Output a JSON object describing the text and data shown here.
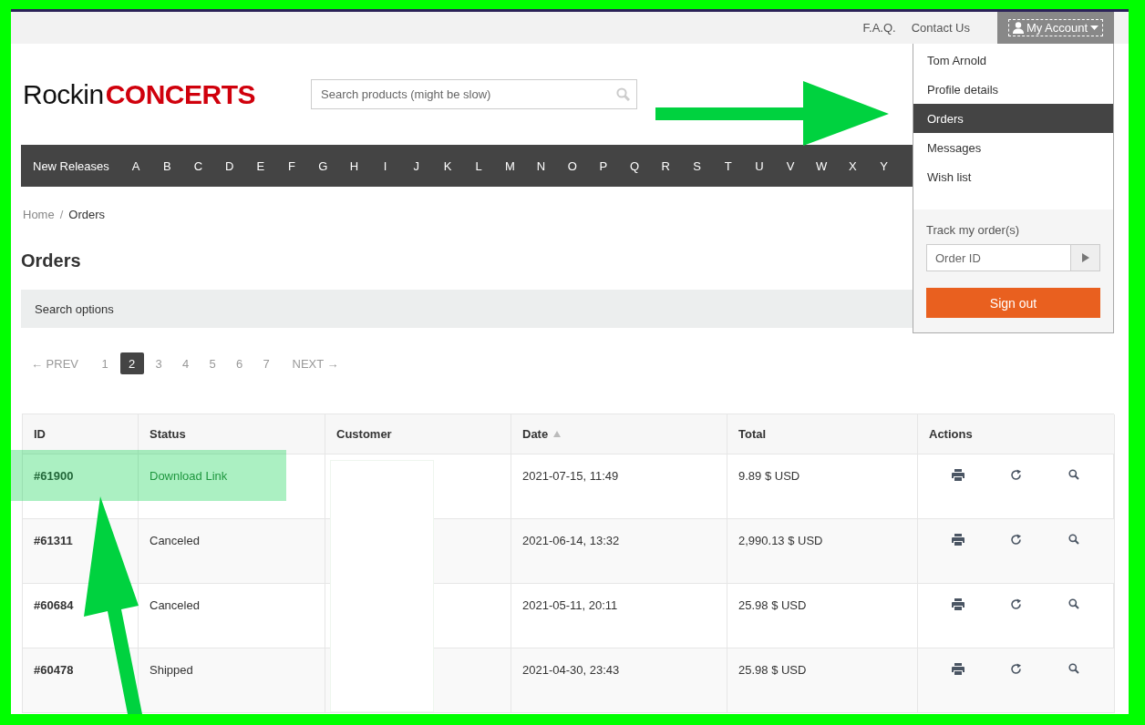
{
  "top_links": [
    {
      "label": "F.A.Q."
    },
    {
      "label": "Contact Us"
    }
  ],
  "account_button": {
    "label": "My Account",
    "expanded": true
  },
  "logo": {
    "part_1": "Rockin",
    "part_2": "CONCERTS"
  },
  "search": {
    "placeholder": "Search products (might be slow)"
  },
  "nav": {
    "first": "New Releases",
    "letters": [
      "A",
      "B",
      "C",
      "D",
      "E",
      "F",
      "G",
      "H",
      "I",
      "J",
      "K",
      "L",
      "M",
      "N",
      "O",
      "P",
      "Q",
      "R",
      "S",
      "T",
      "U",
      "V",
      "W",
      "X",
      "Y"
    ]
  },
  "breadcrumb": [
    {
      "label": "Home"
    },
    {
      "label": "Orders"
    }
  ],
  "breadcrumb_separator": "/",
  "page_title": "Orders",
  "search_options": "Search options",
  "pagination": {
    "prev": "← PREV",
    "next": "NEXT →",
    "pages": [
      {
        "label": "1",
        "selected": false
      },
      {
        "label": "2",
        "selected": true
      },
      {
        "label": "3",
        "selected": false
      },
      {
        "label": "4",
        "selected": false
      },
      {
        "label": "5",
        "selected": false
      },
      {
        "label": "6",
        "selected": false
      },
      {
        "label": "7",
        "selected": false
      }
    ]
  },
  "table": {
    "columns": [
      {
        "label": "ID",
        "sorted": false
      },
      {
        "label": "Status",
        "sorted": false
      },
      {
        "label": "Customer",
        "sorted": false
      },
      {
        "label": "Date",
        "sorted": true
      },
      {
        "label": "Total",
        "sorted": false
      },
      {
        "label": "Actions",
        "sorted": false
      }
    ],
    "rows": [
      {
        "id": "#61900",
        "status": "Download Link",
        "status_link": true,
        "date": "2021-07-15, 11:49",
        "total": "9.89 $ USD",
        "highlighted": true
      },
      {
        "id": "#61311",
        "status": "Canceled",
        "status_link": false,
        "date": "2021-06-14, 13:32",
        "total": "2,990.13 $ USD",
        "highlighted": false
      },
      {
        "id": "#60684",
        "status": "Canceled",
        "status_link": false,
        "date": "2021-05-11, 20:11",
        "total": "25.98 $ USD",
        "highlighted": false
      },
      {
        "id": "#60478",
        "status": "Shipped",
        "status_link": false,
        "date": "2021-04-30, 23:43",
        "total": "25.98 $ USD",
        "highlighted": false
      }
    ]
  },
  "account_menu": {
    "items": [
      {
        "label": "Tom Arnold",
        "selected": false
      },
      {
        "label": "Profile details",
        "selected": false
      },
      {
        "label": "Orders",
        "selected": true
      },
      {
        "label": "Messages",
        "selected": false
      },
      {
        "label": "Wish list",
        "selected": false
      }
    ],
    "track_label": "Track my order(s)",
    "track_placeholder": "Order ID",
    "sign_out": "Sign out"
  }
}
